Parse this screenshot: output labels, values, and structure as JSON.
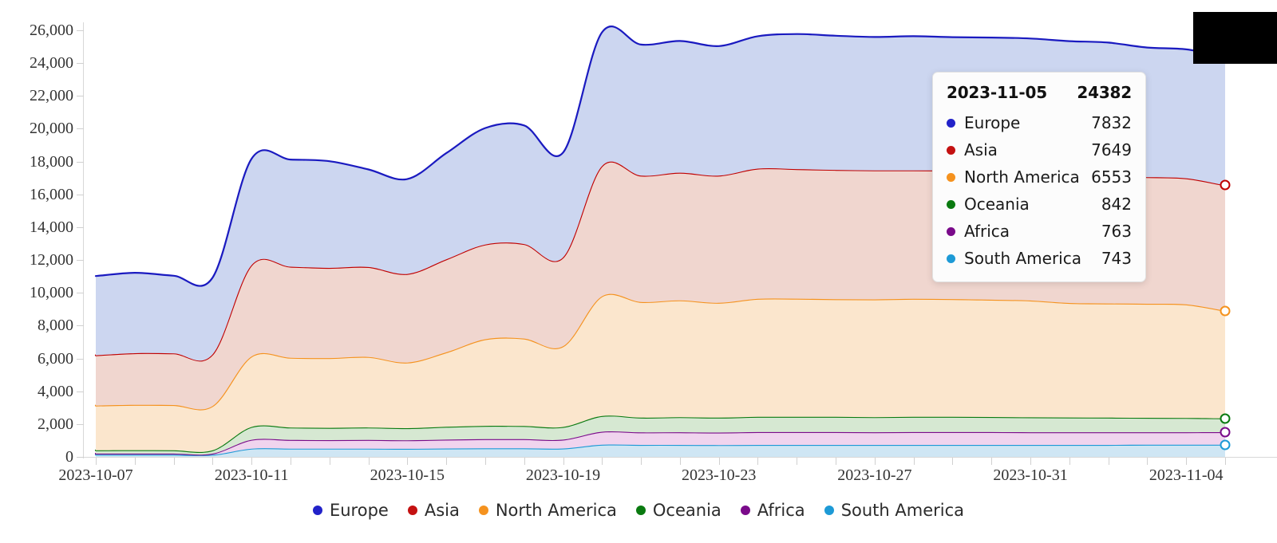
{
  "chart_data": {
    "type": "area",
    "stacked": true,
    "title": "",
    "xlabel": "",
    "ylabel": "",
    "grid": false,
    "legend_position": "bottom",
    "ylim": [
      0,
      26000
    ],
    "yticks": [
      0,
      2000,
      4000,
      6000,
      8000,
      10000,
      12000,
      14000,
      16000,
      18000,
      20000,
      22000,
      24000,
      26000
    ],
    "ytick_labels": [
      "0",
      "2,000",
      "4,000",
      "6,000",
      "8,000",
      "10,000",
      "12,000",
      "14,000",
      "16,000",
      "18,000",
      "20,000",
      "22,000",
      "24,000",
      "26,000"
    ],
    "xtick_labels": [
      "2023-10-07",
      "2023-10-11",
      "2023-10-15",
      "2023-10-19",
      "2023-10-23",
      "2023-10-27",
      "2023-10-31",
      "2023-11-04"
    ],
    "x": [
      "2023-10-07",
      "2023-10-08",
      "2023-10-09",
      "2023-10-10",
      "2023-10-11",
      "2023-10-12",
      "2023-10-13",
      "2023-10-14",
      "2023-10-15",
      "2023-10-16",
      "2023-10-17",
      "2023-10-18",
      "2023-10-19",
      "2023-10-20",
      "2023-10-21",
      "2023-10-22",
      "2023-10-23",
      "2023-10-24",
      "2023-10-25",
      "2023-10-26",
      "2023-10-27",
      "2023-10-28",
      "2023-10-29",
      "2023-10-30",
      "2023-10-31",
      "2023-11-01",
      "2023-11-02",
      "2023-11-03",
      "2023-11-04",
      "2023-11-05"
    ],
    "series": [
      {
        "name": "Europe",
        "color": "#1a1ac0",
        "fill": "#ccd6f0",
        "values": [
          4830,
          4900,
          4730,
          4680,
          6480,
          6530,
          6500,
          5950,
          5780,
          6470,
          7100,
          7230,
          6390,
          8150,
          7990,
          8030,
          7900,
          8070,
          8230,
          8180,
          8130,
          8180,
          8130,
          8180,
          8180,
          8180,
          8130,
          7900,
          7860,
          7832
        ]
      },
      {
        "name": "Asia",
        "color": "#c00000",
        "fill": "#f0d6cf",
        "values": [
          3060,
          3150,
          3150,
          3150,
          5570,
          5550,
          5500,
          5480,
          5400,
          5670,
          5770,
          5760,
          5420,
          7940,
          7700,
          7780,
          7750,
          7940,
          7900,
          7880,
          7860,
          7830,
          7830,
          7800,
          7790,
          7780,
          7770,
          7720,
          7690,
          7649
        ]
      },
      {
        "name": "North America",
        "color": "#f5921e",
        "fill": "#fbe6cd",
        "values": [
          2730,
          2760,
          2760,
          2700,
          4300,
          4250,
          4250,
          4300,
          4000,
          4540,
          5280,
          5330,
          4920,
          7300,
          7050,
          7120,
          7000,
          7190,
          7200,
          7170,
          7180,
          7190,
          7180,
          7150,
          7120,
          6980,
          6960,
          6950,
          6920,
          6553
        ]
      },
      {
        "name": "Oceania",
        "color": "#0a7a10",
        "fill": "#d6e8d2",
        "values": [
          200,
          210,
          200,
          200,
          780,
          760,
          750,
          760,
          740,
          780,
          810,
          800,
          770,
          960,
          900,
          920,
          910,
          930,
          930,
          930,
          920,
          930,
          930,
          920,
          910,
          900,
          890,
          880,
          870,
          842
        ]
      },
      {
        "name": "Africa",
        "color": "#7a0a8a",
        "fill": "#f0d4ee",
        "values": [
          70,
          70,
          70,
          70,
          540,
          530,
          520,
          530,
          520,
          540,
          560,
          560,
          540,
          790,
          760,
          770,
          760,
          780,
          780,
          780,
          770,
          780,
          780,
          780,
          770,
          770,
          770,
          760,
          760,
          763
        ]
      },
      {
        "name": "South America",
        "color": "#1d9ad6",
        "fill": "#cfe6f4",
        "values": [
          130,
          130,
          130,
          130,
          500,
          500,
          500,
          500,
          490,
          510,
          520,
          520,
          510,
          740,
          730,
          730,
          720,
          730,
          730,
          730,
          730,
          730,
          730,
          730,
          730,
          730,
          730,
          740,
          740,
          743
        ]
      }
    ]
  },
  "tooltip": {
    "date": "2023-11-05",
    "total": "24382",
    "rows": [
      {
        "name": "Europe",
        "value": "7832",
        "color": "#2222c9"
      },
      {
        "name": "Asia",
        "value": "7649",
        "color": "#c41111"
      },
      {
        "name": "North America",
        "value": "6553",
        "color": "#f5921e"
      },
      {
        "name": "Oceania",
        "value": "842",
        "color": "#0a7a10"
      },
      {
        "name": "Africa",
        "value": "763",
        "color": "#7a0a8a"
      },
      {
        "name": "South America",
        "value": "743",
        "color": "#1d9ad6"
      }
    ]
  },
  "legend": {
    "items": [
      {
        "label": "Europe",
        "color": "#2222c9"
      },
      {
        "label": "Asia",
        "color": "#c41111"
      },
      {
        "label": "North America",
        "color": "#f5921e"
      },
      {
        "label": "Oceania",
        "color": "#0a7a10"
      },
      {
        "label": "Africa",
        "color": "#7a0a8a"
      },
      {
        "label": "South America",
        "color": "#1d9ad6"
      }
    ]
  },
  "redaction": {
    "present": true,
    "color": "#000000"
  }
}
